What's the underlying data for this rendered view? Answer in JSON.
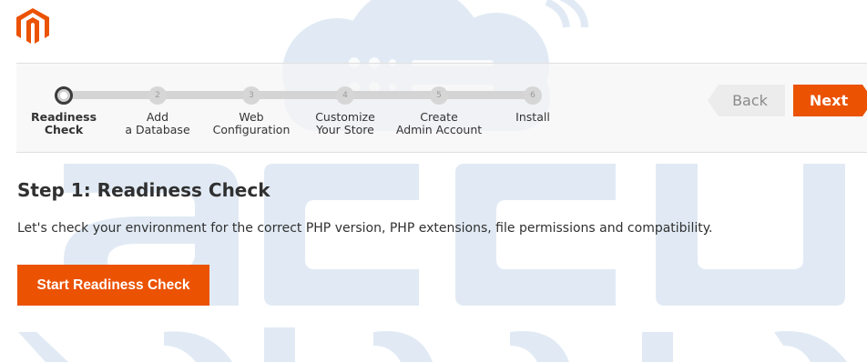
{
  "header": {
    "logo_icon": "magento-logo-icon"
  },
  "wizard": {
    "steps": [
      {
        "number": "",
        "label_line1": "Readiness",
        "label_line2": "Check",
        "active": true
      },
      {
        "number": "2",
        "label_line1": "Add",
        "label_line2": "a Database",
        "active": false
      },
      {
        "number": "3",
        "label_line1": "Web",
        "label_line2": "Configuration",
        "active": false
      },
      {
        "number": "4",
        "label_line1": "Customize",
        "label_line2": "Your Store",
        "active": false
      },
      {
        "number": "5",
        "label_line1": "Create",
        "label_line2": "Admin Account",
        "active": false
      },
      {
        "number": "6",
        "label_line1": "Install",
        "label_line2": "",
        "active": false
      }
    ],
    "back_label": "Back",
    "next_label": "Next"
  },
  "main": {
    "title": "Step 1: Readiness Check",
    "description": "Let's check your environment for the correct PHP version, PHP extensions, file permissions and compatibility.",
    "start_button_label": "Start Readiness Check"
  },
  "colors": {
    "accent": "#eb5202",
    "watermark": "#dfe8f3"
  }
}
